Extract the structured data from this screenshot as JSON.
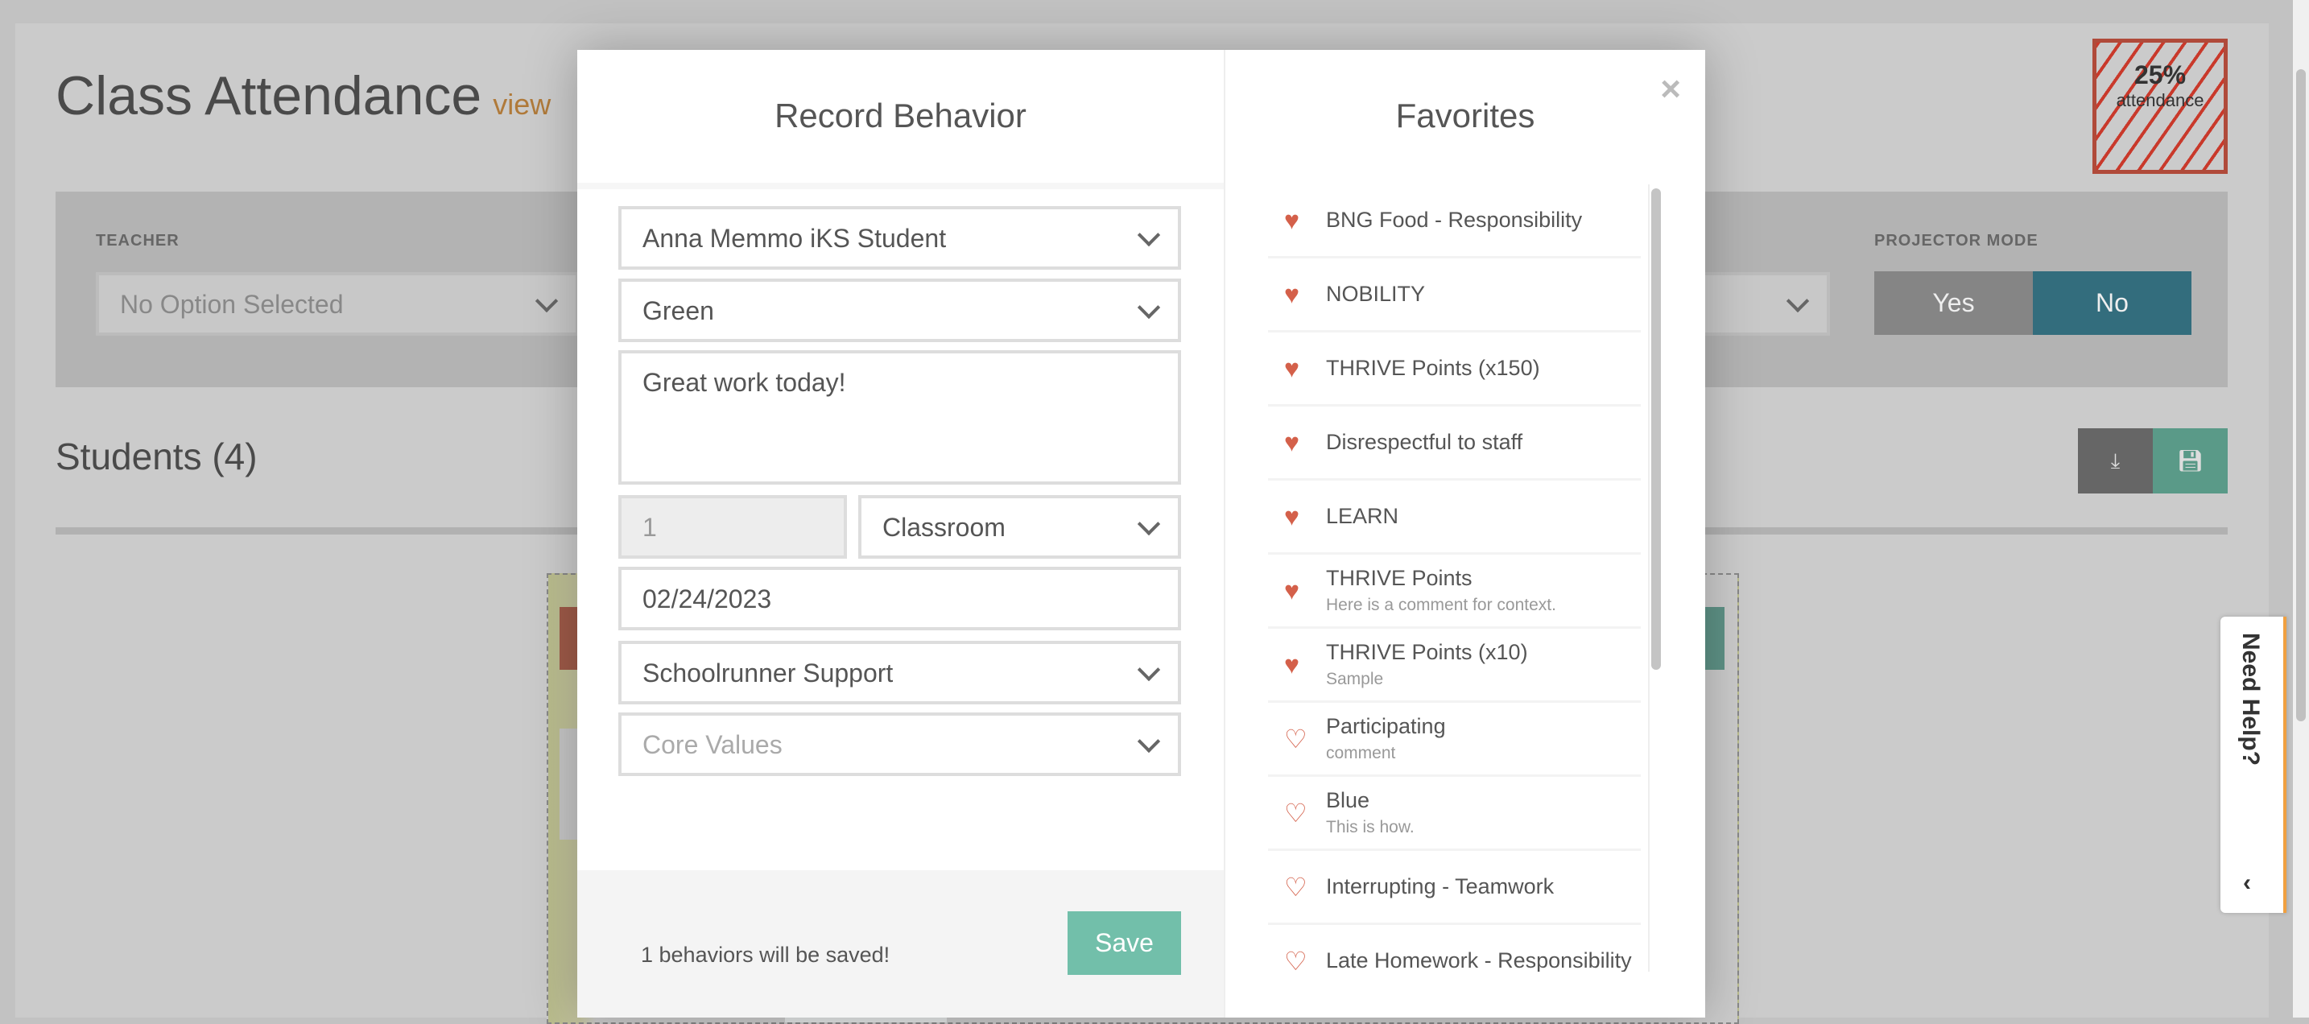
{
  "page": {
    "title": "Class Attendance",
    "title_link": "view",
    "attendance": {
      "percent": "25%",
      "label": "attendance"
    },
    "filters": {
      "teacher_label": "TEACHER",
      "teacher_value": "No Option Selected",
      "projector_label": "PROJECTOR MODE",
      "yes": "Yes",
      "no": "No",
      "projector_selected": "No"
    },
    "students_heading": "Students (4)",
    "icons": {
      "download": "download-icon",
      "save": "floppy-disk-icon"
    }
  },
  "modal": {
    "title": "Record Behavior",
    "student": "Anna Memmo iKS Student",
    "behavior": "Green",
    "comment": "Great work today!",
    "quantity": "1",
    "location": "Classroom",
    "date": "02/24/2023",
    "staff": "Schoolrunner Support",
    "category_placeholder": "Core Values",
    "status": "1 behaviors will be saved!",
    "save_label": "Save"
  },
  "favorites": {
    "title": "Favorites",
    "close": "×",
    "items": [
      {
        "name": "BNG Food - Responsibility",
        "comment": "",
        "favorite": true
      },
      {
        "name": "NOBILITY",
        "comment": "",
        "favorite": true
      },
      {
        "name": "THRIVE Points (x150)",
        "comment": "",
        "favorite": true
      },
      {
        "name": "Disrespectful to staff",
        "comment": "",
        "favorite": true
      },
      {
        "name": "LEARN",
        "comment": "",
        "favorite": true
      },
      {
        "name": "THRIVE Points",
        "comment": "Here is a comment for context.",
        "favorite": true
      },
      {
        "name": "THRIVE Points (x10)",
        "comment": "Sample",
        "favorite": true
      },
      {
        "name": "Participating",
        "comment": "comment",
        "favorite": false
      },
      {
        "name": "Blue",
        "comment": "This is how.",
        "favorite": false
      },
      {
        "name": "Interrupting - Teamwork",
        "comment": "",
        "favorite": false
      },
      {
        "name": "Late Homework - Responsibility",
        "comment": "",
        "favorite": false
      }
    ]
  },
  "help": {
    "label": "Need Help?",
    "chevron": "‹"
  },
  "colors": {
    "accent_teal": "#72bfaa",
    "projector_no": "#336d7d",
    "heart": "#d4604a",
    "attendance_border": "#b04a3a"
  }
}
